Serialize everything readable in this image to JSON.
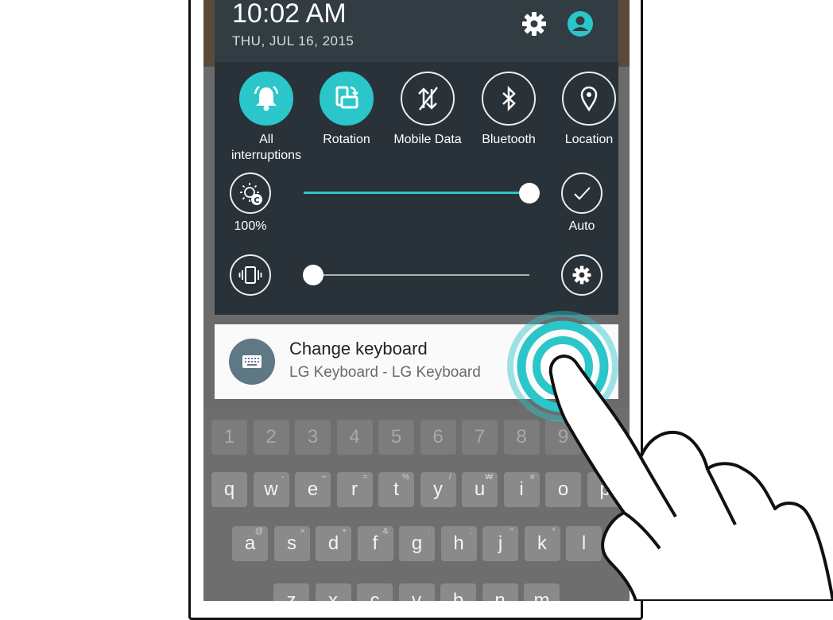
{
  "status": {
    "time": "10:02 AM",
    "date": "THU, JUL 16, 2015"
  },
  "header_icons": [
    "gear-icon",
    "profile-icon"
  ],
  "quick_settings": [
    {
      "label": "All interruptions",
      "icon": "bell-icon",
      "active": true
    },
    {
      "label": "Rotation",
      "icon": "rotation-icon",
      "active": true
    },
    {
      "label": "Mobile Data",
      "icon": "mobile-data-icon",
      "active": false
    },
    {
      "label": "Bluetooth",
      "icon": "bluetooth-icon",
      "active": false
    },
    {
      "label": "Location",
      "icon": "location-icon",
      "active": false
    }
  ],
  "brightness": {
    "value_label": "100%",
    "auto_label": "Auto",
    "level": 1.0
  },
  "volume": {
    "level": 0.0
  },
  "notification": {
    "title": "Change keyboard",
    "subtitle": "LG Keyboard - LG Keyboard",
    "icon": "keyboard-icon"
  },
  "keyboard": {
    "number_row": [
      "1",
      "2",
      "3",
      "4",
      "5",
      "6",
      "7",
      "8",
      "9"
    ],
    "row1": [
      {
        "key": "q",
        "sup": ""
      },
      {
        "key": "w",
        "sup": "-"
      },
      {
        "key": "e",
        "sup": "÷"
      },
      {
        "key": "r",
        "sup": "="
      },
      {
        "key": "t",
        "sup": "%"
      },
      {
        "key": "y",
        "sup": "/"
      },
      {
        "key": "u",
        "sup": "₩"
      },
      {
        "key": "i",
        "sup": "#"
      },
      {
        "key": "o",
        "sup": ""
      },
      {
        "key": "p",
        "sup": "!"
      }
    ],
    "row2": [
      {
        "key": "a",
        "sup": "@"
      },
      {
        "key": "s",
        "sup": "×"
      },
      {
        "key": "d",
        "sup": "+"
      },
      {
        "key": "f",
        "sup": "&"
      },
      {
        "key": "g",
        "sup": ":"
      },
      {
        "key": "h",
        "sup": ";"
      },
      {
        "key": "j",
        "sup": "^"
      },
      {
        "key": "k",
        "sup": "*"
      },
      {
        "key": "l",
        "sup": ""
      }
    ],
    "row3": [
      "z",
      "x",
      "c",
      "v",
      "b",
      "n",
      "m"
    ]
  },
  "colors": {
    "accent": "#2ac6c9",
    "shade": "#283238",
    "header": "#323d43",
    "notif_icon": "#5e7885"
  }
}
